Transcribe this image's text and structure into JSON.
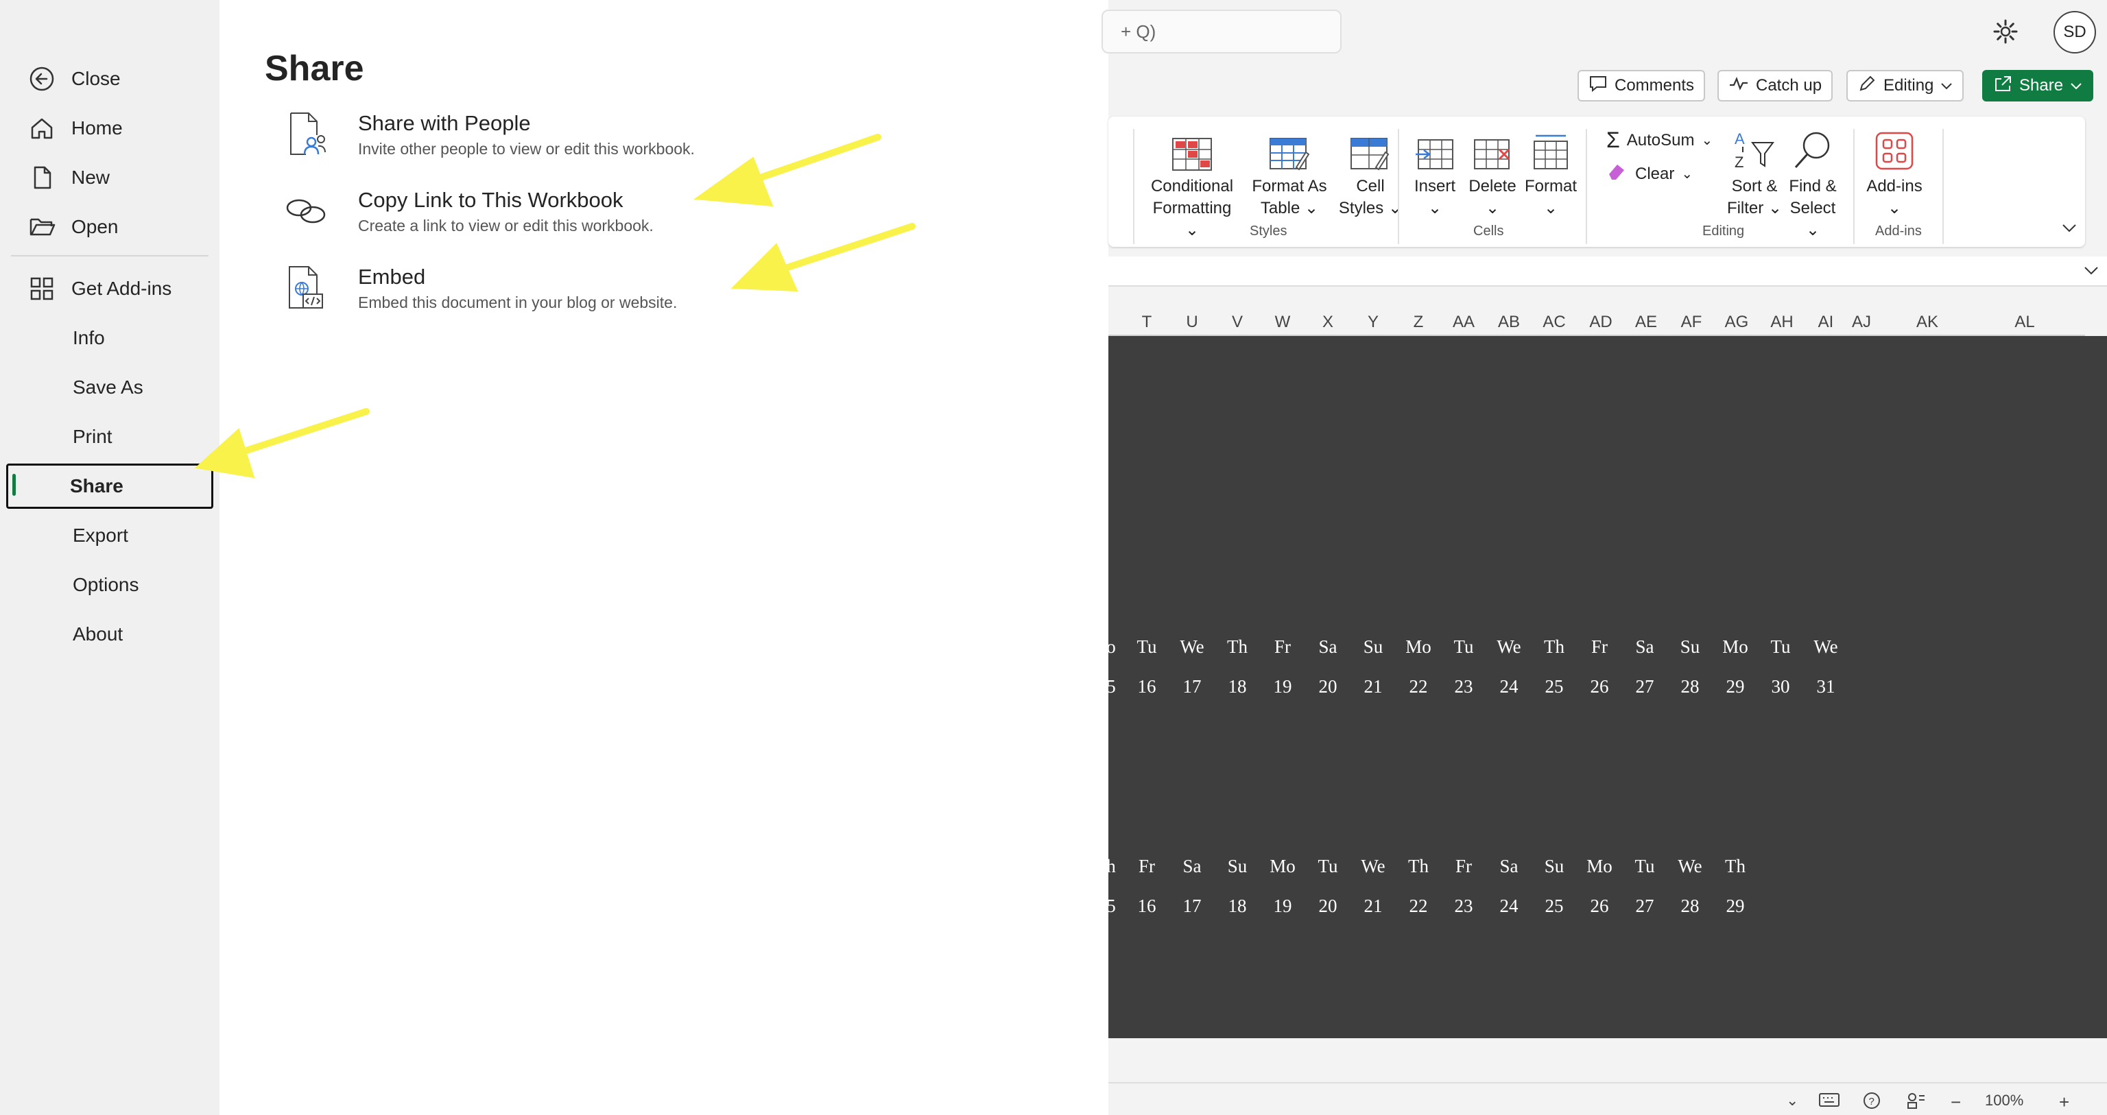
{
  "nav": {
    "items": [
      {
        "label": "Close",
        "icon": "back-arrow-icon"
      },
      {
        "label": "Home",
        "icon": "home-icon"
      },
      {
        "label": "New",
        "icon": "new-document-icon"
      },
      {
        "label": "Open",
        "icon": "folder-open-icon"
      },
      {
        "label": "Get Add-ins",
        "icon": "add-ins-grid-icon"
      },
      {
        "label": "Info"
      },
      {
        "label": "Save As"
      },
      {
        "label": "Print"
      },
      {
        "label": "Share",
        "active": true
      },
      {
        "label": "Export"
      },
      {
        "label": "Options"
      },
      {
        "label": "About"
      }
    ]
  },
  "share": {
    "title": "Share",
    "options": [
      {
        "title": "Share with People",
        "desc": "Invite other people to view or edit this workbook.",
        "icon": "share-people-icon"
      },
      {
        "title": "Copy Link to This Workbook",
        "desc": "Create a link to view or edit this workbook.",
        "icon": "link-icon"
      },
      {
        "title": "Embed",
        "desc": "Embed this document in your blog or website.",
        "icon": "embed-icon"
      }
    ]
  },
  "excel": {
    "search_text": "+ Q)",
    "avatar_initials": "SD",
    "top_buttons": {
      "comments": "Comments",
      "catch_up": "Catch up",
      "editing": "Editing",
      "share": "Share"
    },
    "ribbon": {
      "conditional_formatting": [
        "Conditional",
        "Formatting"
      ],
      "format_as_table": [
        "Format As",
        "Table"
      ],
      "cell_styles": [
        "Cell",
        "Styles"
      ],
      "insert": "Insert",
      "delete": "Delete",
      "format": "Format",
      "autosum": "AutoSum",
      "clear": "Clear",
      "sort_filter": [
        "Sort &",
        "Filter"
      ],
      "find_select": [
        "Find &",
        "Select"
      ],
      "add_ins": "Add-ins",
      "groups": {
        "styles": "Styles",
        "cells": "Cells",
        "editing": "Editing",
        "add_ins": "Add-ins"
      }
    },
    "columns": [
      "T",
      "U",
      "V",
      "W",
      "X",
      "Y",
      "Z",
      "AA",
      "AB",
      "AC",
      "AD",
      "AE",
      "AF",
      "AG",
      "AH",
      "AI",
      "AJ",
      "AK",
      "AL"
    ],
    "calendar_rows": [
      {
        "days": [
          "o",
          "Tu",
          "We",
          "Th",
          "Fr",
          "Sa",
          "Su",
          "Mo",
          "Tu",
          "We",
          "Th",
          "Fr",
          "Sa",
          "Su",
          "Mo",
          "Tu",
          "We"
        ],
        "dates": [
          "5",
          "16",
          "17",
          "18",
          "19",
          "20",
          "21",
          "22",
          "23",
          "24",
          "25",
          "26",
          "27",
          "28",
          "29",
          "30",
          "31"
        ]
      },
      {
        "days": [
          "h",
          "Fr",
          "Sa",
          "Su",
          "Mo",
          "Tu",
          "We",
          "Th",
          "Fr",
          "Sa",
          "Su",
          "Mo",
          "Tu",
          "We",
          "Th"
        ],
        "dates": [
          "5",
          "16",
          "17",
          "18",
          "19",
          "20",
          "21",
          "22",
          "23",
          "24",
          "25",
          "26",
          "27",
          "28",
          "29"
        ]
      }
    ],
    "zoom": "100%"
  },
  "colors": {
    "accent_green": "#107c41",
    "annotation_yellow": "#f8f24a"
  }
}
